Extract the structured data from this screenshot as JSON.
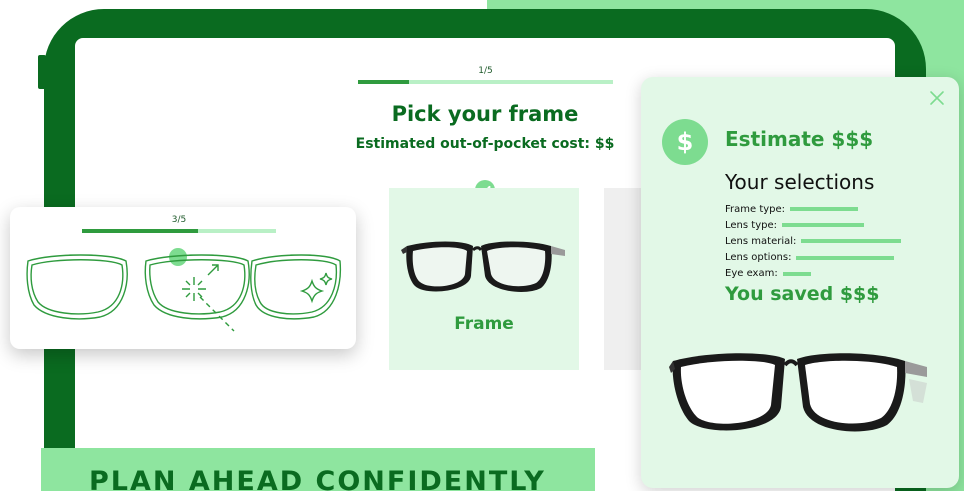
{
  "main": {
    "progress_text": "1/5",
    "progress_fraction": 0.2,
    "title": "Pick your frame",
    "subtitle": "Estimated out-of-pocket cost: $$",
    "selected_card_label": "Frame"
  },
  "lens_card": {
    "progress_text": "3/5",
    "progress_fraction": 0.6
  },
  "banner": {
    "text": "PLAN AHEAD CONFIDENTLY"
  },
  "estimate_panel": {
    "badge_symbol": "$",
    "title": "Estimate $$$",
    "selections_title": "Your selections",
    "rows": [
      {
        "label": "Frame type:"
      },
      {
        "label": "Lens type:"
      },
      {
        "label": "Lens material:"
      },
      {
        "label": "Lens options:"
      },
      {
        "label": "Eye exam:"
      }
    ],
    "saved_text": "You saved $$$"
  },
  "colors": {
    "dark_green": "#0a6b20",
    "mid_green": "#2f9b3e",
    "light_green": "#8ee59f",
    "pale_green": "#e2f8e7"
  }
}
